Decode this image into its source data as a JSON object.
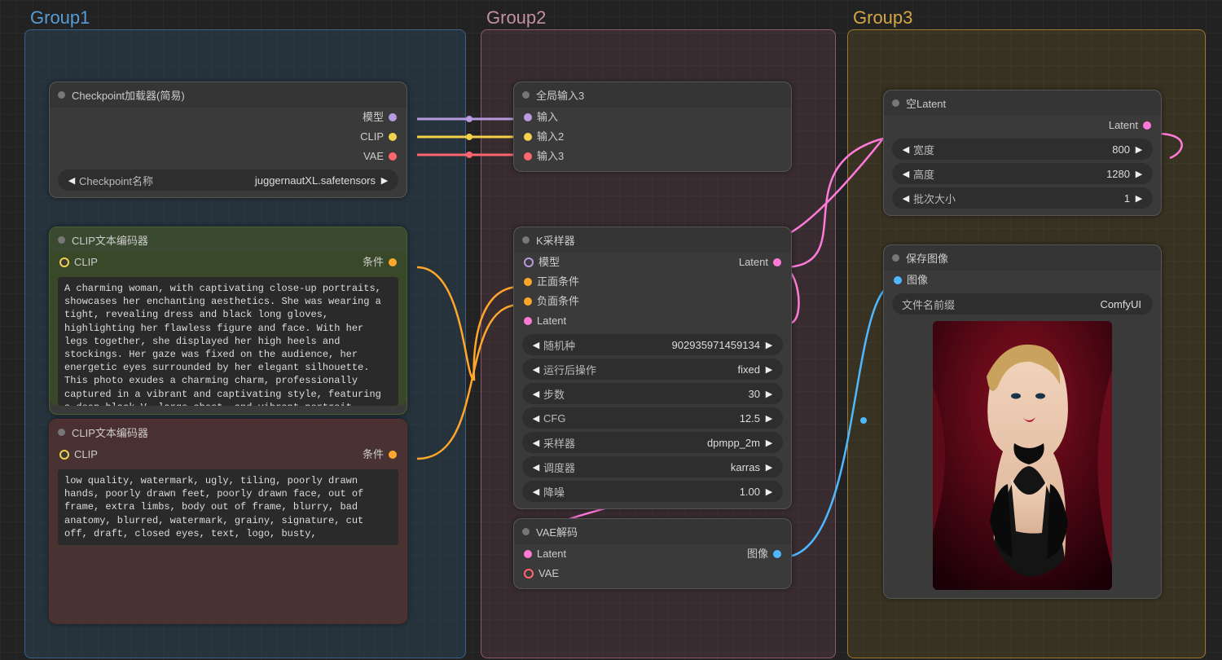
{
  "groups": {
    "g1": "Group1",
    "g2": "Group2",
    "g3": "Group3"
  },
  "checkpoint": {
    "title": "Checkpoint加载器(简易)",
    "outputs": {
      "model": "模型",
      "clip": "CLIP",
      "vae": "VAE"
    },
    "widget": {
      "label": "Checkpoint名称",
      "value": "juggernautXL.safetensors"
    }
  },
  "clipPos": {
    "title": "CLIP文本编码器",
    "in": "CLIP",
    "out": "条件",
    "text": "A charming woman, with captivating close-up portraits, showcases her enchanting aesthetics. She was wearing a tight, revealing dress and black long gloves, highlighting her flawless figure and face. With her legs together, she displayed her high heels and stockings. Her gaze was fixed on the audience, her energetic eyes surrounded by her elegant silhouette. This photo exudes a charming charm, professionally captured in a vibrant and captivating style, featuring a deep black V, large chest, and vibrant portrait photography"
  },
  "clipNeg": {
    "title": "CLIP文本编码器",
    "in": "CLIP",
    "out": "条件",
    "text": "low quality, watermark, ugly, tiling, poorly drawn hands, poorly drawn feet, poorly drawn face, out of frame, extra limbs, body out of frame, blurry, bad anatomy, blurred, watermark, grainy, signature, cut off, draft, closed eyes, text, logo, busty,"
  },
  "global": {
    "title": "全局输入3",
    "inputs": {
      "a": "输入",
      "b": "输入2",
      "c": "输入3"
    }
  },
  "ksampler": {
    "title": "K采样器",
    "inputs": {
      "model": "模型",
      "pos": "正面条件",
      "neg": "负面条件",
      "latent": "Latent"
    },
    "output": "Latent",
    "widgets": [
      {
        "label": "随机种",
        "value": "902935971459134"
      },
      {
        "label": "运行后操作",
        "value": "fixed"
      },
      {
        "label": "步数",
        "value": "30"
      },
      {
        "label": "CFG",
        "value": "12.5"
      },
      {
        "label": "采样器",
        "value": "dpmpp_2m"
      },
      {
        "label": "调度器",
        "value": "karras"
      },
      {
        "label": "降噪",
        "value": "1.00"
      }
    ]
  },
  "vaedecode": {
    "title": "VAE解码",
    "inputs": {
      "latent": "Latent",
      "vae": "VAE"
    },
    "output": "图像"
  },
  "emptyLatent": {
    "title": "空Latent",
    "output": "Latent",
    "widgets": [
      {
        "label": "宽度",
        "value": "800"
      },
      {
        "label": "高度",
        "value": "1280"
      },
      {
        "label": "批次大小",
        "value": "1"
      }
    ]
  },
  "saveImage": {
    "title": "保存图像",
    "input": "图像",
    "widget": {
      "label": "文件名前缀",
      "value": "ComfyUI"
    }
  },
  "colors": {
    "model": "#b89ae0",
    "clip": "#f3d24b",
    "vae": "#ff6670",
    "cond": "#ffa62b",
    "latent": "#ff7ad9",
    "image": "#4fb8ff"
  }
}
